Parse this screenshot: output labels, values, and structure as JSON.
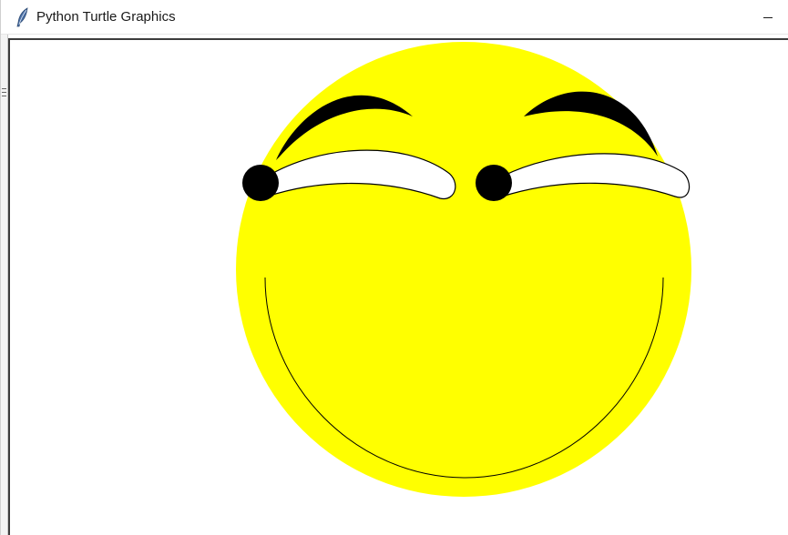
{
  "window": {
    "title": "Python Turtle Graphics",
    "icon": "feather-icon",
    "minimize_icon": "minimize-icon"
  },
  "canvas": {
    "background": "#ffffff",
    "face_color": "#ffff00",
    "eye_white_color": "#ffffff",
    "pupil_color": "#000000",
    "brow_color": "#000000",
    "mouth_color": "#000000",
    "outline_color": "#000000"
  }
}
